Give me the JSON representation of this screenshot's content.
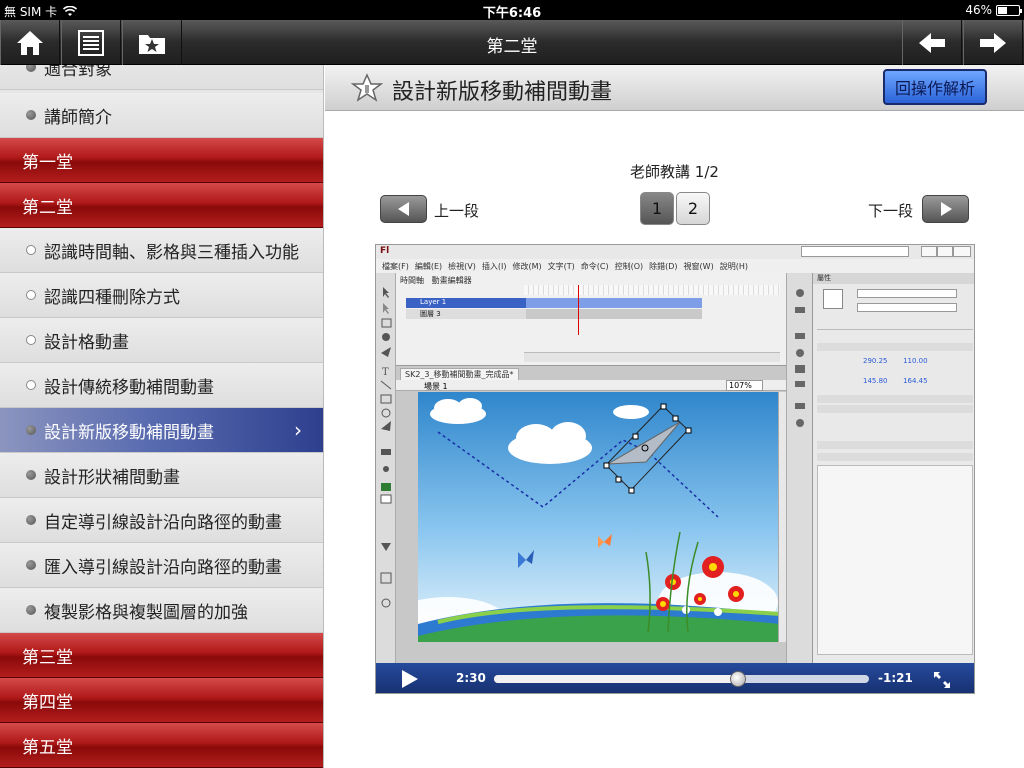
{
  "status": {
    "carrier": "無 SIM 卡",
    "time": "下午6:46",
    "battery": "46%",
    "battery_level": 0.46
  },
  "nav": {
    "title": "第二堂"
  },
  "sidebar": {
    "items": [
      {
        "label": "適合對象",
        "kind": "lesson"
      },
      {
        "label": "講師簡介",
        "kind": "lesson"
      },
      {
        "label": "第一堂",
        "kind": "chapter"
      },
      {
        "label": "第二堂",
        "kind": "chapter"
      },
      {
        "label": "認識時間軸、影格與三種插入功能",
        "kind": "lesson-hollow"
      },
      {
        "label": "認識四種刪除方式",
        "kind": "lesson-hollow"
      },
      {
        "label": "設計格動畫",
        "kind": "lesson-hollow"
      },
      {
        "label": "設計傳統移動補間動畫",
        "kind": "lesson-hollow"
      },
      {
        "label": "設計新版移動補間動畫",
        "kind": "active"
      },
      {
        "label": "設計形狀補間動畫",
        "kind": "lesson"
      },
      {
        "label": "自定導引線設計沿向路徑的動畫",
        "kind": "lesson"
      },
      {
        "label": "匯入導引線設計沿向路徑的動畫",
        "kind": "lesson"
      },
      {
        "label": "複製影格與複製圖層的加強",
        "kind": "lesson"
      },
      {
        "label": "第三堂",
        "kind": "chapter"
      },
      {
        "label": "第四堂",
        "kind": "chapter"
      },
      {
        "label": "第五堂",
        "kind": "chapter"
      }
    ]
  },
  "main": {
    "title": "設計新版移動補間動畫",
    "analysis_button": "回操作解析",
    "subtitle": "老師教講 1/2",
    "prev_label": "上一段",
    "next_label": "下一段",
    "pages": [
      "1",
      "2"
    ]
  },
  "video": {
    "app_logo": "Fl",
    "menus": [
      "檔案(F)",
      "編輯(E)",
      "檢視(V)",
      "插入(I)",
      "修改(M)",
      "文字(T)",
      "命令(C)",
      "控制(O)",
      "除錯(D)",
      "視窗(W)",
      "說明(H)"
    ],
    "layers": [
      "Layer 1",
      "圖層 3"
    ],
    "scene": "場景 1",
    "zoom": "107%",
    "props_panel": "屬性",
    "elapsed": "2:30",
    "remaining": "-1:21",
    "progress": 0.65
  }
}
